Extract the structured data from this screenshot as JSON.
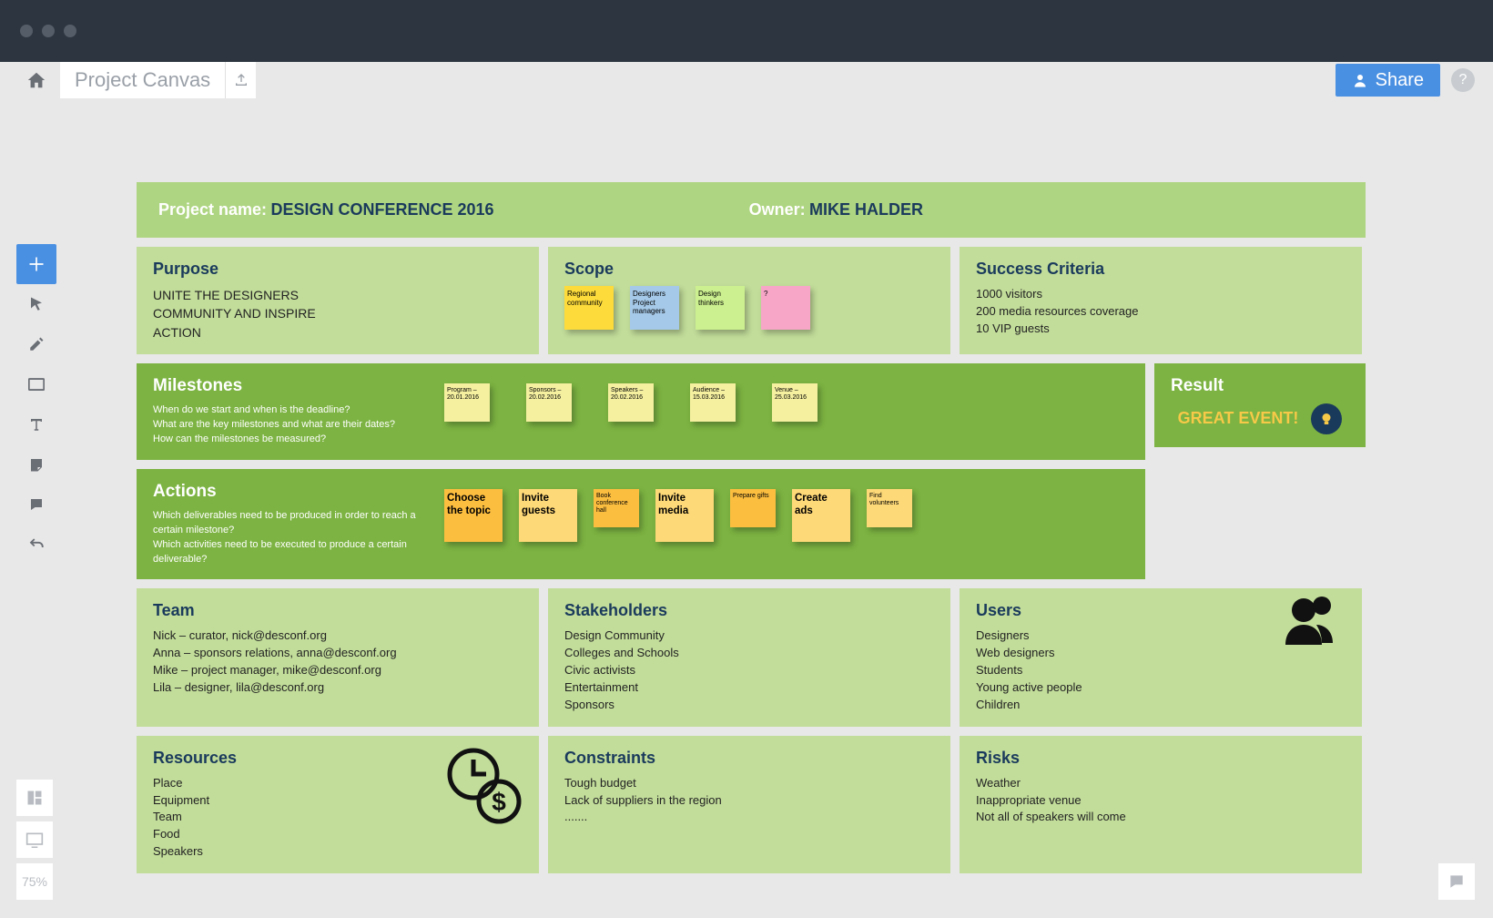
{
  "app": {
    "title": "Project Canvas",
    "zoom": "75%"
  },
  "topnav": {
    "share_label": "Share"
  },
  "header": {
    "project_name_label": "Project name:",
    "project_name_value": "DESIGN CONFERENCE 2016",
    "owner_label": "Owner:",
    "owner_value": "MIKE HALDER"
  },
  "panels": {
    "purpose": {
      "title": "Purpose",
      "text": "UNITE THE DESIGNERS COMMUNITY AND INSPIRE ACTION"
    },
    "scope": {
      "title": "Scope",
      "stickies": [
        {
          "text": "Regional community",
          "color": "yellow"
        },
        {
          "text": "Designers Project managers",
          "color": "blue"
        },
        {
          "text": "Design thinkers",
          "color": "green"
        },
        {
          "text": "?",
          "color": "pink"
        }
      ]
    },
    "success": {
      "title": "Success Criteria",
      "items": [
        "1000 visitors",
        "200 media resources coverage",
        "10 VIP guests"
      ]
    },
    "milestones": {
      "title": "Milestones",
      "hints": [
        "When do we start and when is the deadline?",
        "What are the key milestones and what are their dates?",
        "How can the milestones be measured?"
      ],
      "stickies": [
        {
          "text": "Program – 20.01.2016"
        },
        {
          "text": "Sponsors – 20.02.2016"
        },
        {
          "text": "Speakers – 20.02.2016"
        },
        {
          "text": "Audience – 15.03.2016"
        },
        {
          "text": "Venue – 25.03.2016"
        }
      ]
    },
    "actions": {
      "title": "Actions",
      "hints": [
        "Which deliverables need to be produced in order to reach a certain milestone?",
        "Which activities need to be executed to produce a certain deliverable?"
      ],
      "stickies": [
        {
          "text": "Choose the topic",
          "size": "lg",
          "color": "orange"
        },
        {
          "text": "Invite guests",
          "size": "lg",
          "color": "lightorange"
        },
        {
          "text": "Book conference hall",
          "size": "sm",
          "color": "orange"
        },
        {
          "text": "Invite media",
          "size": "lg",
          "color": "lightorange"
        },
        {
          "text": "Prepare gifts",
          "size": "sm",
          "color": "orange"
        },
        {
          "text": "Create ads",
          "size": "lg",
          "color": "lightorange"
        },
        {
          "text": "Find volunteers",
          "size": "sm",
          "color": "lightorange"
        }
      ]
    },
    "result": {
      "title": "Result",
      "text": "GREAT EVENT!"
    },
    "team": {
      "title": "Team",
      "items": [
        "Nick –  curator, nick@desconf.org",
        "Anna –  sponsors relations, anna@desconf.org",
        "Mike –  project manager, mike@desconf.org",
        "Lila –  designer, lila@desconf.org"
      ]
    },
    "stakeholders": {
      "title": "Stakeholders",
      "items": [
        "Design Community",
        "Colleges and Schools",
        "Civic activists",
        "Entertainment",
        "Sponsors"
      ]
    },
    "users": {
      "title": "Users",
      "items": [
        "Designers",
        "Web designers",
        "Students",
        "Young active people",
        "Children"
      ]
    },
    "resources": {
      "title": "Resources",
      "items": [
        "Place",
        "Equipment",
        "Team",
        "Food",
        "Speakers"
      ]
    },
    "constraints": {
      "title": "Constraints",
      "items": [
        "Tough budget",
        "Lack of suppliers in the region",
        "......."
      ]
    },
    "risks": {
      "title": "Risks",
      "items": [
        "Weather",
        "Inappropriate venue",
        "Not all of speakers will come"
      ]
    }
  }
}
